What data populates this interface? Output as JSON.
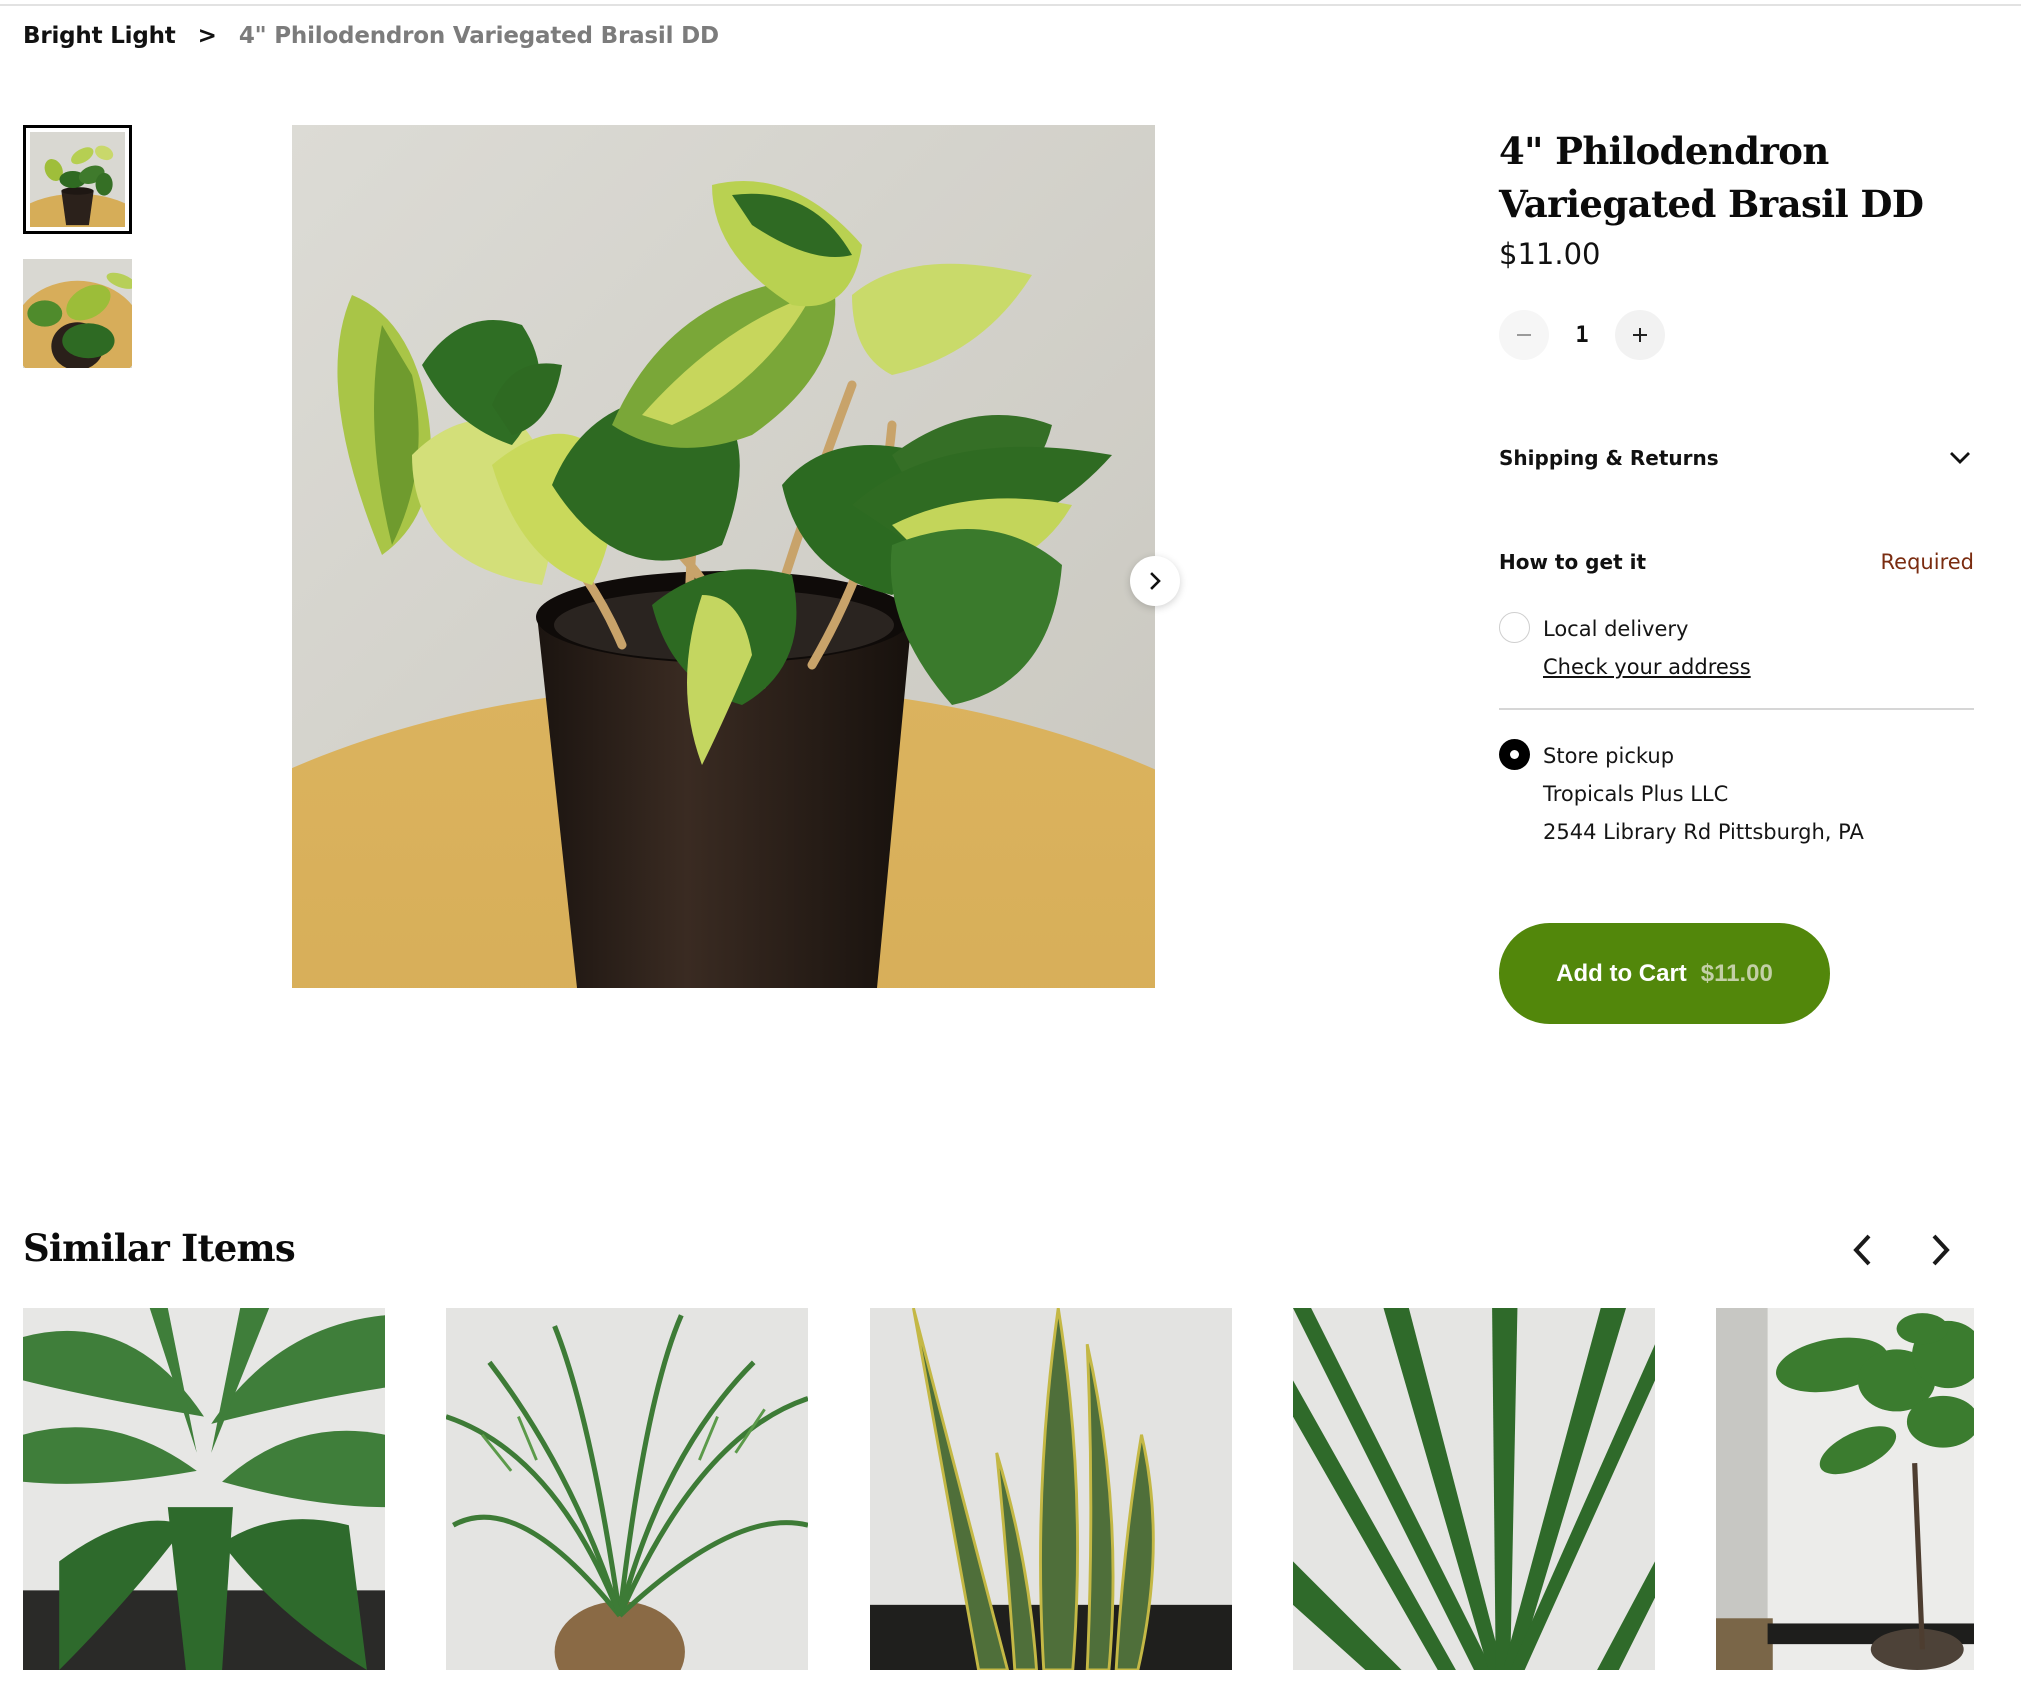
{
  "breadcrumb": {
    "parent": "Bright Light",
    "separator": ">",
    "current": "4\" Philodendron Variegated Brasil DD"
  },
  "gallery": {
    "thumbnails": [
      {
        "alt": "Philodendron Brasil in pot, side view",
        "selected": true
      },
      {
        "alt": "Philodendron Brasil, top view",
        "selected": false
      }
    ],
    "main_image_alt": "4\" Philodendron Variegated Brasil in black pot on wooden stool",
    "next_icon": "chevron-right-icon"
  },
  "product": {
    "title": "4\" Philodendron Variegated Brasil DD",
    "price": "$11.00",
    "quantity": "1",
    "decrement_icon": "minus-icon",
    "increment_icon": "plus-icon"
  },
  "shipping": {
    "label": "Shipping & Returns",
    "icon": "chevron-down-icon"
  },
  "fulfillment": {
    "label": "How to get it",
    "required_label": "Required",
    "options": [
      {
        "label": "Local delivery",
        "link": "Check your address",
        "selected": false
      },
      {
        "label": "Store pickup",
        "store_name": "Tropicals Plus LLC",
        "address": "2544 Library Rd Pittsburgh, PA",
        "selected": true
      }
    ]
  },
  "cart": {
    "label": "Add to Cart",
    "price": "$11.00"
  },
  "similar": {
    "title": "Similar Items",
    "prev_icon": "chevron-left-icon",
    "next_icon": "chevron-right-icon",
    "items": [
      {
        "alt": "Fan palm plant"
      },
      {
        "alt": "Pygmy date palm in woven basket"
      },
      {
        "alt": "Snake plant"
      },
      {
        "alt": "Palm fronds"
      },
      {
        "alt": "Fiddle leaf fig tree"
      }
    ]
  },
  "colors": {
    "accent": "#52870b",
    "required": "#7a2c10",
    "breadcrumb_current": "#7c7c7c"
  }
}
